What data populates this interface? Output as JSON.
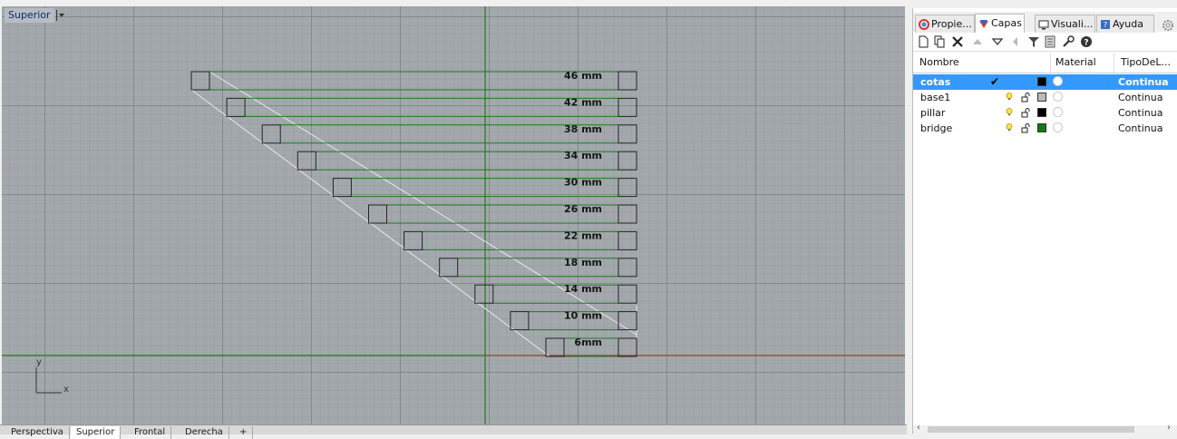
{
  "viewport": {
    "title": "Superior",
    "axis_x": "x",
    "axis_y": "y",
    "dimensions": [
      "46 mm",
      "42 mm",
      "38 mm",
      "34 mm",
      "30 mm",
      "26 mm",
      "22 mm",
      "18 mm",
      "14 mm",
      "10 mm",
      "6mm"
    ]
  },
  "bottom_tabs": [
    "Perspectiva",
    "Superior",
    "Frontal",
    "Derecha",
    "+"
  ],
  "panel": {
    "tabs": [
      {
        "label": "Propie...",
        "icon": "properties-icon"
      },
      {
        "label": "Capas",
        "icon": "layers-icon"
      },
      {
        "label": "Visuali...",
        "icon": "display-icon"
      },
      {
        "label": "Ayuda",
        "icon": "help-icon"
      }
    ],
    "toolbar_icons": [
      "new-layer-icon",
      "new-sublayer-icon",
      "delete-icon",
      "move-up-icon",
      "move-down-icon",
      "move-left-icon",
      "filter-icon",
      "layer-states-icon",
      "tools-icon",
      "help-icon"
    ],
    "columns": {
      "name": "Nombre",
      "material": "Material",
      "linetype": "TipoDeL..."
    },
    "layers": [
      {
        "name": "cotas",
        "current": true,
        "color": "#000000",
        "linetype": "Continua"
      },
      {
        "name": "base1",
        "current": false,
        "color": "#bbbbbb",
        "linetype": "Continua"
      },
      {
        "name": "pillar",
        "current": false,
        "color": "#000000",
        "linetype": "Continua"
      },
      {
        "name": "bridge",
        "current": false,
        "color": "#117a11",
        "linetype": "Continua"
      }
    ]
  }
}
